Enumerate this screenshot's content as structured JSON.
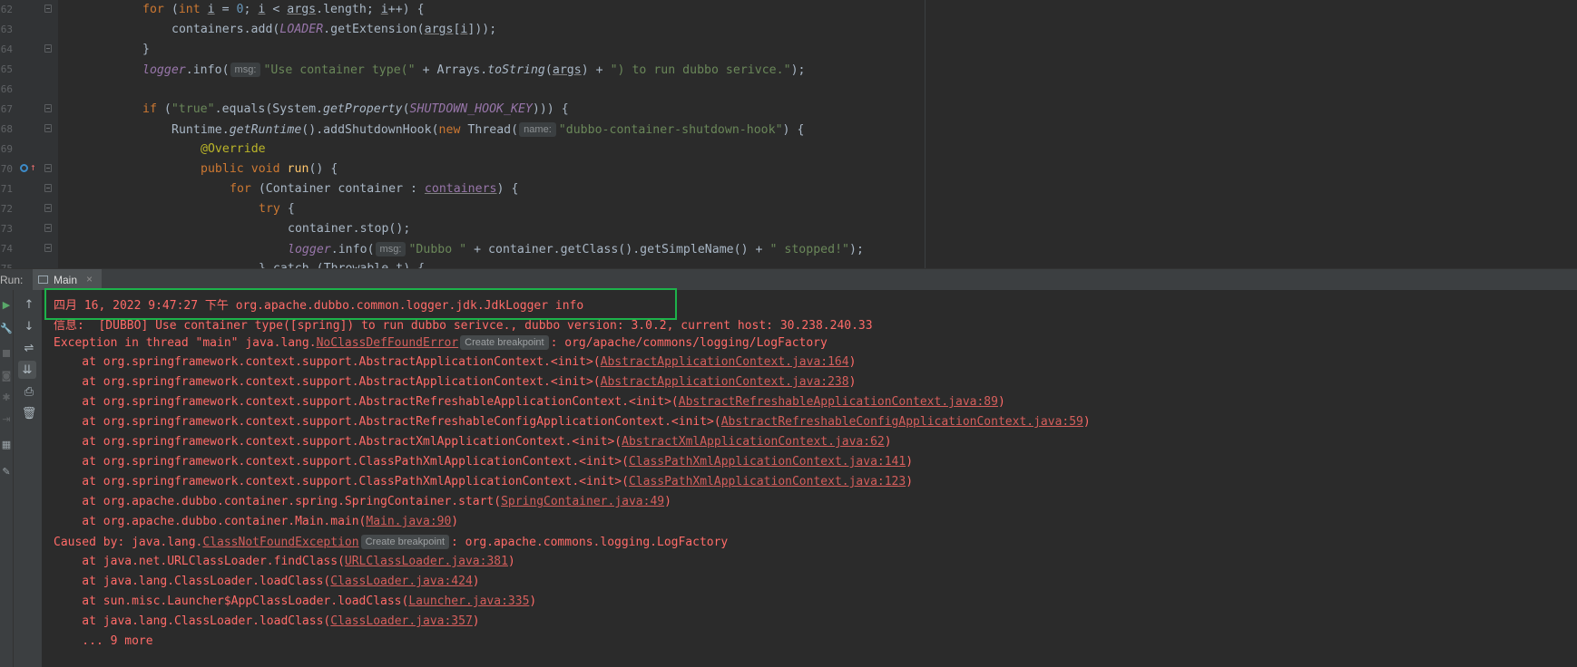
{
  "editor": {
    "lines": [
      {
        "num": "62",
        "segments": [
          {
            "t": "for",
            "c": "kw"
          },
          {
            "t": " (",
            "c": ""
          },
          {
            "t": "int",
            "c": "kw"
          },
          {
            "t": " ",
            "c": ""
          },
          {
            "t": "i",
            "c": "und"
          },
          {
            "t": " = ",
            "c": ""
          },
          {
            "t": "0",
            "c": "num"
          },
          {
            "t": "; ",
            "c": ""
          },
          {
            "t": "i",
            "c": "und"
          },
          {
            "t": " < ",
            "c": ""
          },
          {
            "t": "args",
            "c": "und"
          },
          {
            "t": ".length; ",
            "c": ""
          },
          {
            "t": "i",
            "c": "und"
          },
          {
            "t": "++) {",
            "c": ""
          }
        ]
      },
      {
        "num": "63",
        "segments": [
          {
            "t": "containers.add(",
            "c": ""
          },
          {
            "t": "LOADER",
            "c": "fld"
          },
          {
            "t": ".getExtension(",
            "c": ""
          },
          {
            "t": "args",
            "c": "und"
          },
          {
            "t": "[",
            "c": ""
          },
          {
            "t": "i",
            "c": "und"
          },
          {
            "t": "]));",
            "c": ""
          }
        ]
      },
      {
        "num": "64",
        "segments": [
          {
            "t": "}",
            "c": ""
          }
        ]
      },
      {
        "num": "65",
        "segments": [
          {
            "t": "logger",
            "c": "fld"
          },
          {
            "t": ".info(",
            "c": ""
          },
          {
            "t": "msg:",
            "c": "hint"
          },
          {
            "t": "\"Use container type(\"",
            "c": "str"
          },
          {
            "t": " + Arrays.",
            "c": ""
          },
          {
            "t": "toString",
            "c": "ital"
          },
          {
            "t": "(",
            "c": ""
          },
          {
            "t": "args",
            "c": "und"
          },
          {
            "t": ") + ",
            "c": ""
          },
          {
            "t": "\") to run dubbo serivce.\"",
            "c": "str"
          },
          {
            "t": ");",
            "c": ""
          }
        ]
      },
      {
        "num": "66",
        "segments": []
      },
      {
        "num": "67",
        "segments": [
          {
            "t": "if",
            "c": "kw"
          },
          {
            "t": " (",
            "c": ""
          },
          {
            "t": "\"true\"",
            "c": "str"
          },
          {
            "t": ".equals(System.",
            "c": ""
          },
          {
            "t": "getProperty",
            "c": "ital"
          },
          {
            "t": "(",
            "c": ""
          },
          {
            "t": "SHUTDOWN_HOOK_KEY",
            "c": "fld"
          },
          {
            "t": "))) {",
            "c": ""
          }
        ]
      },
      {
        "num": "68",
        "segments": [
          {
            "t": "Runtime.",
            "c": ""
          },
          {
            "t": "getRuntime",
            "c": "ital"
          },
          {
            "t": "().addShutdownHook(",
            "c": ""
          },
          {
            "t": "new",
            "c": "kw"
          },
          {
            "t": " Thread(",
            "c": ""
          },
          {
            "t": "name:",
            "c": "hint"
          },
          {
            "t": "\"dubbo-container-shutdown-hook\"",
            "c": "str"
          },
          {
            "t": ") {",
            "c": ""
          }
        ]
      },
      {
        "num": "69",
        "segments": [
          {
            "t": "@Override",
            "c": "ann"
          }
        ]
      },
      {
        "num": "70",
        "segments": [
          {
            "t": "public",
            "c": "kw"
          },
          {
            "t": " ",
            "c": ""
          },
          {
            "t": "void",
            "c": "kw"
          },
          {
            "t": " ",
            "c": ""
          },
          {
            "t": "run",
            "c": "fn"
          },
          {
            "t": "() {",
            "c": ""
          }
        ]
      },
      {
        "num": "71",
        "segments": [
          {
            "t": "for",
            "c": "kw"
          },
          {
            "t": " (Container container : ",
            "c": ""
          },
          {
            "t": "containers",
            "c": "loc und"
          },
          {
            "t": ") {",
            "c": ""
          }
        ]
      },
      {
        "num": "72",
        "segments": [
          {
            "t": "try",
            "c": "kw"
          },
          {
            "t": " {",
            "c": ""
          }
        ]
      },
      {
        "num": "73",
        "segments": [
          {
            "t": "container.stop();",
            "c": ""
          }
        ]
      },
      {
        "num": "74",
        "segments": [
          {
            "t": "logger",
            "c": "fld"
          },
          {
            "t": ".info(",
            "c": ""
          },
          {
            "t": "msg:",
            "c": "hint"
          },
          {
            "t": "\"Dubbo \"",
            "c": "str"
          },
          {
            "t": " + container.getClass().getSimpleName() + ",
            "c": ""
          },
          {
            "t": "\" stopped!\"",
            "c": "str"
          },
          {
            "t": ");",
            "c": ""
          }
        ]
      },
      {
        "num": "75",
        "segments": [
          {
            "t": "} catch (Throwable t) {",
            "c": ""
          }
        ]
      }
    ]
  },
  "run": {
    "label": "Run:",
    "tab_label": "Main",
    "tab_close": "×"
  },
  "toolbar": {
    "rerun": "▶",
    "settings": "🔧",
    "up": "↑",
    "down": "↓",
    "soft_wrap": "⇌",
    "scroll_end": "⇊",
    "print": "⎙",
    "clear": "🗑"
  },
  "console": {
    "lines": [
      {
        "segments": [
          {
            "t": "四月 16, 2022 9:47:27 下午 org.apache.dubbo.common.logger.jdk.JdkLogger info"
          }
        ]
      },
      {
        "segments": [
          {
            "t": "信息:  [DUBBO] Use container type([spring]) to run dubbo serivce., dubbo version: 3.0.2, current host: 30.238.240.33"
          }
        ]
      },
      {
        "segments": [
          {
            "t": "Exception in thread \"main\" java.lang."
          },
          {
            "t": "NoClassDefFoundError",
            "k": "lnk"
          },
          {
            "t": "Create breakpoint",
            "k": "cb"
          },
          {
            "t": ": org/apache/commons/logging/LogFactory"
          }
        ]
      },
      {
        "segments": [
          {
            "t": "    at org.springframework.context.support.AbstractApplicationContext.<init>("
          },
          {
            "t": "AbstractApplicationContext.java:164",
            "k": "lnk"
          },
          {
            "t": ")"
          }
        ]
      },
      {
        "segments": [
          {
            "t": "    at org.springframework.context.support.AbstractApplicationContext.<init>("
          },
          {
            "t": "AbstractApplicationContext.java:238",
            "k": "lnk"
          },
          {
            "t": ")"
          }
        ]
      },
      {
        "segments": [
          {
            "t": "    at org.springframework.context.support.AbstractRefreshableApplicationContext.<init>("
          },
          {
            "t": "AbstractRefreshableApplicationContext.java:89",
            "k": "lnk"
          },
          {
            "t": ")"
          }
        ]
      },
      {
        "segments": [
          {
            "t": "    at org.springframework.context.support.AbstractRefreshableConfigApplicationContext.<init>("
          },
          {
            "t": "AbstractRefreshableConfigApplicationContext.java:59",
            "k": "lnk"
          },
          {
            "t": ")"
          }
        ]
      },
      {
        "segments": [
          {
            "t": "    at org.springframework.context.support.AbstractXmlApplicationContext.<init>("
          },
          {
            "t": "AbstractXmlApplicationContext.java:62",
            "k": "lnk"
          },
          {
            "t": ")"
          }
        ]
      },
      {
        "segments": [
          {
            "t": "    at org.springframework.context.support.ClassPathXmlApplicationContext.<init>("
          },
          {
            "t": "ClassPathXmlApplicationContext.java:141",
            "k": "lnk"
          },
          {
            "t": ")"
          }
        ]
      },
      {
        "segments": [
          {
            "t": "    at org.springframework.context.support.ClassPathXmlApplicationContext.<init>("
          },
          {
            "t": "ClassPathXmlApplicationContext.java:123",
            "k": "lnk"
          },
          {
            "t": ")"
          }
        ]
      },
      {
        "segments": [
          {
            "t": "    at org.apache.dubbo.container.spring.SpringContainer.start("
          },
          {
            "t": "SpringContainer.java:49",
            "k": "lnk"
          },
          {
            "t": ")"
          }
        ]
      },
      {
        "segments": [
          {
            "t": "    at org.apache.dubbo.container.Main.main("
          },
          {
            "t": "Main.java:90",
            "k": "lnk"
          },
          {
            "t": ")"
          }
        ]
      },
      {
        "segments": [
          {
            "t": "Caused by: java.lang."
          },
          {
            "t": "ClassNotFoundException",
            "k": "lnk"
          },
          {
            "t": "Create breakpoint",
            "k": "cb"
          },
          {
            "t": ": org.apache.commons.logging.LogFactory"
          }
        ]
      },
      {
        "segments": [
          {
            "t": "    at java.net.URLClassLoader.findClass("
          },
          {
            "t": "URLClassLoader.java:381",
            "k": "lnk"
          },
          {
            "t": ")"
          }
        ]
      },
      {
        "segments": [
          {
            "t": "    at java.lang.ClassLoader.loadClass("
          },
          {
            "t": "ClassLoader.java:424",
            "k": "lnk"
          },
          {
            "t": ")"
          }
        ]
      },
      {
        "segments": [
          {
            "t": "    at sun.misc.Launcher$AppClassLoader.loadClass("
          },
          {
            "t": "Launcher.java:335",
            "k": "lnk"
          },
          {
            "t": ")"
          }
        ]
      },
      {
        "segments": [
          {
            "t": "    at java.lang.ClassLoader.loadClass("
          },
          {
            "t": "ClassLoader.java:357",
            "k": "lnk"
          },
          {
            "t": ")"
          }
        ]
      },
      {
        "segments": [
          {
            "t": "    ... 9 more"
          }
        ]
      }
    ]
  },
  "colors": {
    "console_error": "#ff6b68",
    "highlight_box": "#1db24a",
    "editor_bg": "#2b2b2b"
  }
}
